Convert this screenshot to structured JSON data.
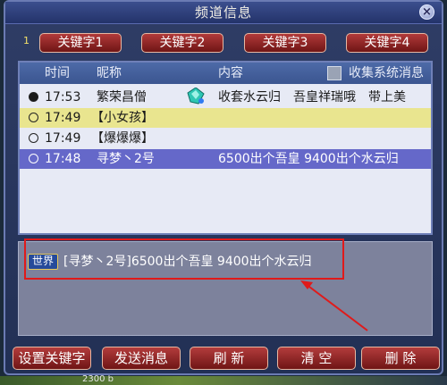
{
  "window": {
    "title": "频道信息",
    "close_label": "×"
  },
  "keywords": {
    "index": "1",
    "buttons": [
      "关键字1",
      "关键字2",
      "关键字3",
      "关键字4"
    ]
  },
  "message_list": {
    "headers": {
      "time": "时间",
      "nickname": "昵称",
      "content": "内容",
      "collect": "收集系统消息"
    },
    "rows": [
      {
        "time": "17:53",
        "nickname": "繁荣昌僧",
        "content": "收套水云归　吾皇祥瑞哦　带上美",
        "radio": "filled",
        "icon": "gem-icon"
      },
      {
        "time": "17:49",
        "nickname": "【小女孩】",
        "content": "",
        "radio": "empty"
      },
      {
        "time": "17:49",
        "nickname": "【爆爆爆】",
        "content": "",
        "radio": "empty"
      },
      {
        "time": "17:48",
        "nickname": "寻梦丶2号",
        "content": "6500出个吾皇 9400出个水云归",
        "radio": "empty",
        "selected": true
      }
    ],
    "row_colors": [
      "#e7eaf5",
      "#e9e58f",
      "#e7eaf5",
      "#6568c9"
    ]
  },
  "detail": {
    "channel_badge": "世界",
    "text": "[寻梦丶2号]6500出个吾皇 9400出个水云归"
  },
  "bottom_buttons": [
    "设置关键字",
    "发送消息",
    "刷 新",
    "清 空",
    "删 除"
  ],
  "footer_fragment": "2300 b",
  "colors": {
    "accent_red": "#e01a1a",
    "button_red": "#8a2020",
    "selected_row": "#6568c9",
    "highlight_row": "#e9e58f"
  }
}
